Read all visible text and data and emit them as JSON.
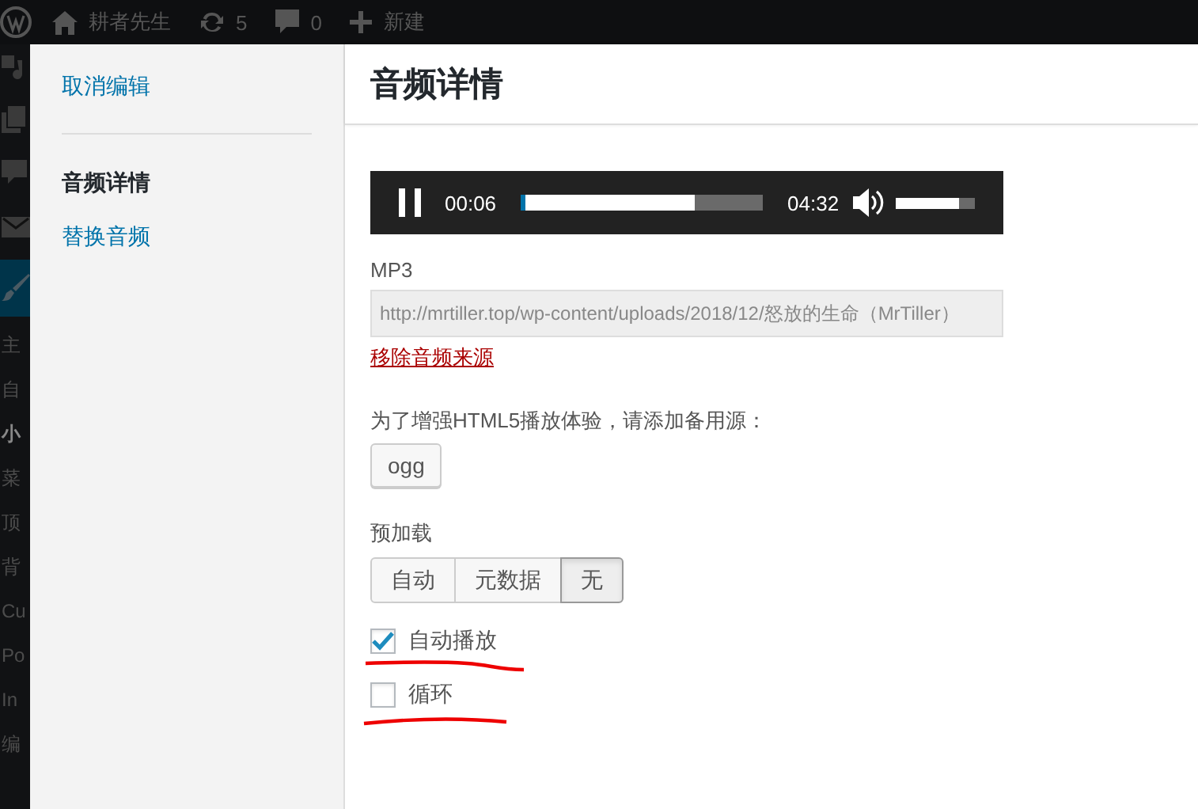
{
  "admin_bar": {
    "items": [
      {
        "kind": "logo"
      },
      {
        "kind": "home",
        "label": "耕者先生"
      },
      {
        "kind": "updates",
        "label": "5"
      },
      {
        "kind": "comments",
        "label": "0"
      },
      {
        "kind": "new",
        "label": "新建"
      }
    ]
  },
  "admin_menu": {
    "items": [
      {
        "label": "主"
      },
      {
        "label": "自"
      },
      {
        "label": "小",
        "selected": true
      },
      {
        "label": "菜"
      },
      {
        "label": "顶"
      },
      {
        "label": "背"
      },
      {
        "label": "Cu"
      },
      {
        "label": "Po"
      },
      {
        "label": "In"
      },
      {
        "label": "编"
      }
    ]
  },
  "modal": {
    "sidebar": {
      "cancel_link": "取消编辑",
      "items": [
        {
          "label": "音频详情",
          "selected": true
        },
        {
          "label": "替换音频",
          "selected": false
        }
      ]
    },
    "title": "音频详情",
    "player": {
      "playing": true,
      "current_time": "00:06",
      "duration": "04:32",
      "progress": {
        "level": 0.02
      },
      "buffered": {
        "level": 0.72
      },
      "volume": {
        "level": 0.8
      }
    },
    "source": {
      "label": "MP3",
      "value": "http://mrtiller.top/wp-content/uploads/2018/12/怒放的生命（MrTiller）",
      "remove_link": "移除音频来源"
    },
    "fallback": {
      "hint": "为了增强HTML5播放体验，请添加备用源：",
      "buttons": [
        "ogg"
      ]
    },
    "preload": {
      "label": "预加载",
      "options": [
        {
          "label": "自动",
          "selected": false
        },
        {
          "label": "元数据",
          "selected": false
        },
        {
          "label": "无",
          "selected": true
        }
      ]
    },
    "options": [
      {
        "label": "自动播放",
        "checked": true
      },
      {
        "label": "循环",
        "checked": false
      }
    ]
  }
}
